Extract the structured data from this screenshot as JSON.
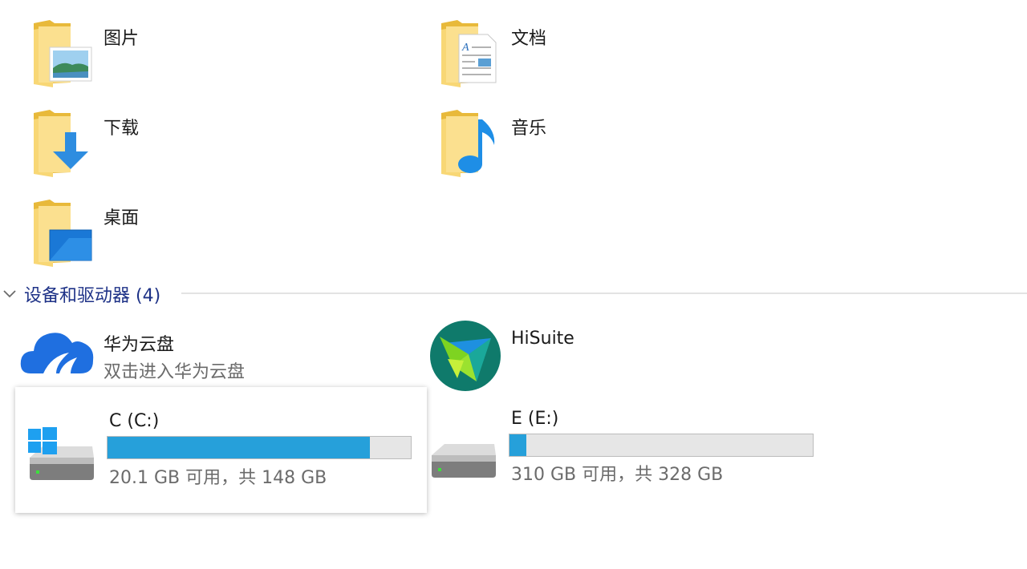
{
  "folders": [
    {
      "label": "图片",
      "icon": "pictures-folder-icon"
    },
    {
      "label": "文档",
      "icon": "documents-folder-icon"
    },
    {
      "label": "下载",
      "icon": "downloads-folder-icon"
    },
    {
      "label": "音乐",
      "icon": "music-folder-icon"
    },
    {
      "label": "桌面",
      "icon": "desktop-folder-icon"
    }
  ],
  "devices_group": {
    "title": "设备和驱动器 (4)",
    "expanded": true
  },
  "devices": [
    {
      "name": "华为云盘",
      "subtitle": "双击进入华为云盘",
      "icon": "huawei-cloud-icon"
    },
    {
      "name": "HiSuite",
      "icon": "hisuite-icon"
    }
  ],
  "drives": [
    {
      "name": "C (C:)",
      "info": "20.1 GB 可用，共 148 GB",
      "used_fraction": 0.864,
      "selected": true,
      "icon": "windows-drive-icon"
    },
    {
      "name": "E  (E:)",
      "info": "310 GB 可用，共 328 GB",
      "used_fraction": 0.055,
      "selected": false,
      "icon": "drive-icon"
    }
  ],
  "colors": {
    "folder": "#f8d775",
    "folder_dark": "#e8b93a",
    "accent": "#26a0da",
    "group_title": "#1e3287",
    "huawei_blue": "#1f6fe0",
    "hisuite_teal": "#0f7a6b"
  }
}
